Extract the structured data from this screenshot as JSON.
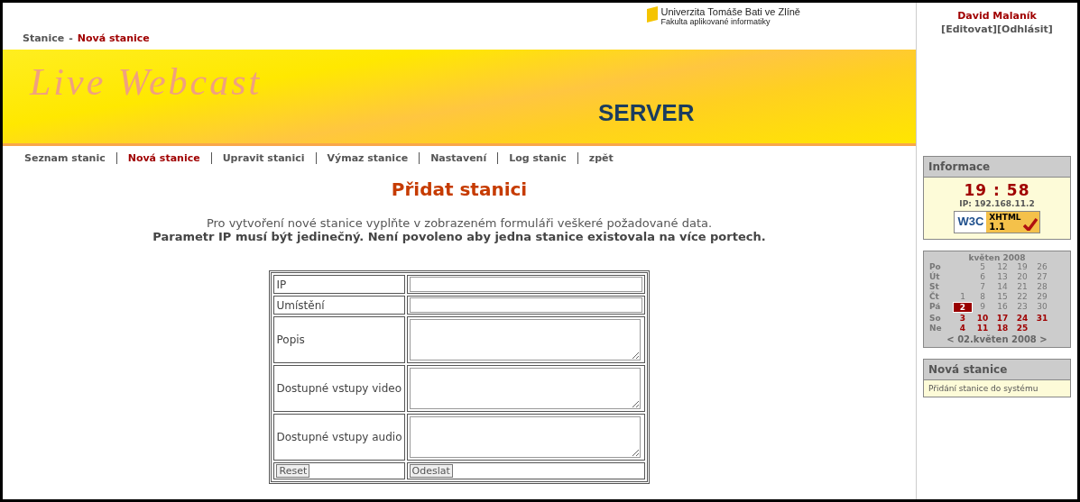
{
  "breadcrumb": {
    "section": "Stanice",
    "separator": "-",
    "current": "Nová stanice"
  },
  "university": {
    "name": "Univerzita Tomáše Bati ve Zlíně",
    "faculty": "Fakulta aplikované informatiky"
  },
  "banner": {
    "title": "Live Webcast",
    "subtitle": "SERVER"
  },
  "nav": [
    {
      "label": "Seznam stanic",
      "selected": false
    },
    {
      "label": "Nová stanice",
      "selected": true
    },
    {
      "label": "Upravit stanici",
      "selected": false
    },
    {
      "label": "Výmaz stanice",
      "selected": false
    },
    {
      "label": "Nastavení",
      "selected": false
    },
    {
      "label": "Log stanic",
      "selected": false
    },
    {
      "label": "zpět",
      "selected": false
    }
  ],
  "heading": "Přidat stanici",
  "intro": "Pro vytvoření nové stanice vyplňte v zobrazeném formuláři veškeré požadované data.",
  "note": "Parametr IP musí být jedinečný. Není povoleno aby jedna stanice existovala na více portech.",
  "form": {
    "fields": [
      {
        "label": "IP",
        "kind": "input"
      },
      {
        "label": "Umístění",
        "kind": "input"
      },
      {
        "label": "Popis",
        "kind": "textarea"
      },
      {
        "label": "Dostupné vstupy video",
        "kind": "textarea"
      },
      {
        "label": "Dostupné vstupy audio",
        "kind": "textarea"
      }
    ],
    "buttons": [
      "Reset",
      "Odeslat"
    ]
  },
  "user": {
    "name": "David Malaník",
    "links": [
      "[Editovat]",
      "[Odhlásit]"
    ]
  },
  "info": {
    "title": "Informace",
    "time": "19 : 58",
    "ip": "IP: 192.168.11.2",
    "badge_left": "W3C",
    "badge_right": "XHTML",
    "badge_version": "1.1"
  },
  "calendar": {
    "title": "květen 2008",
    "rows": [
      {
        "day": "Po",
        "cells": [
          {
            "kind": "blank"
          },
          {
            "text": "5",
            "kind": "plain"
          },
          {
            "text": "12",
            "kind": "plain"
          },
          {
            "text": "19",
            "kind": "plain"
          },
          {
            "text": "26",
            "kind": "plain"
          }
        ]
      },
      {
        "day": "Út",
        "cells": [
          {
            "kind": "blank"
          },
          {
            "text": "6",
            "kind": "plain"
          },
          {
            "text": "13",
            "kind": "plain"
          },
          {
            "text": "20",
            "kind": "plain"
          },
          {
            "text": "27",
            "kind": "plain"
          }
        ]
      },
      {
        "day": "St",
        "cells": [
          {
            "kind": "blank"
          },
          {
            "text": "7",
            "kind": "plain"
          },
          {
            "text": "14",
            "kind": "plain"
          },
          {
            "text": "21",
            "kind": "plain"
          },
          {
            "text": "28",
            "kind": "plain"
          }
        ]
      },
      {
        "day": "Čt",
        "cells": [
          {
            "text": "1",
            "kind": "plain"
          },
          {
            "text": "8",
            "kind": "plain"
          },
          {
            "text": "15",
            "kind": "plain"
          },
          {
            "text": "22",
            "kind": "plain"
          },
          {
            "text": "29",
            "kind": "plain"
          }
        ]
      },
      {
        "day": "Pá",
        "cells": [
          {
            "text": "2",
            "kind": "today"
          },
          {
            "text": "9",
            "kind": "plain"
          },
          {
            "text": "16",
            "kind": "plain"
          },
          {
            "text": "23",
            "kind": "plain"
          },
          {
            "text": "30",
            "kind": "plain"
          }
        ]
      },
      {
        "day": "So",
        "cells": [
          {
            "text": "3",
            "kind": "weekend"
          },
          {
            "text": "10",
            "kind": "weekend"
          },
          {
            "text": "17",
            "kind": "weekend"
          },
          {
            "text": "24",
            "kind": "weekend"
          },
          {
            "text": "31",
            "kind": "weekend"
          }
        ]
      },
      {
        "day": "Ne",
        "cells": [
          {
            "text": "4",
            "kind": "weekend"
          },
          {
            "text": "11",
            "kind": "weekend"
          },
          {
            "text": "18",
            "kind": "weekend"
          },
          {
            "text": "25",
            "kind": "weekend"
          },
          {
            "kind": "blank"
          }
        ]
      }
    ],
    "nav": "< 02.květen 2008 >"
  },
  "section": {
    "title": "Nová stanice",
    "text": "Přidání stanice do systému"
  }
}
